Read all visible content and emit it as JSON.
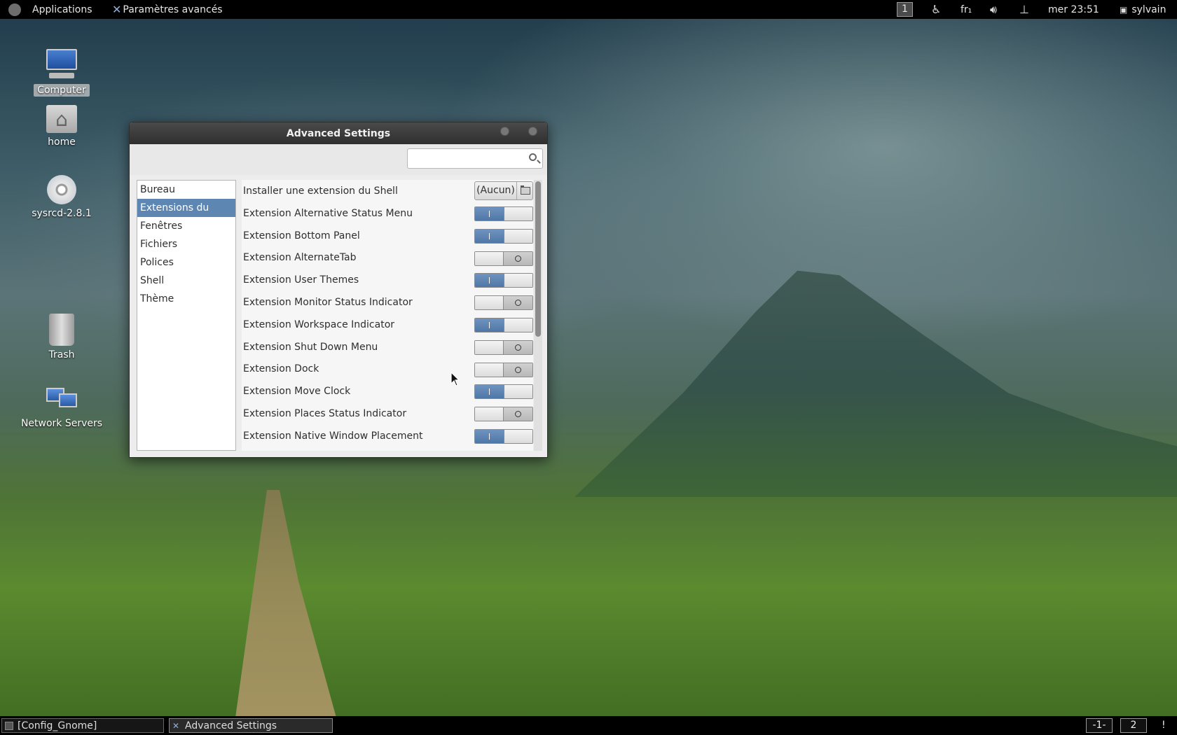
{
  "top_panel": {
    "applications": "Applications",
    "app_menu": "Paramètres avancés",
    "workspace": "1",
    "keyboard": "fr₁",
    "clock": "mer 23:51",
    "user": "sylvain",
    "icons": [
      "accessibility-icon",
      "volume-icon",
      "network-icon",
      "user-icon"
    ]
  },
  "desktop": {
    "icons": [
      {
        "label": "Computer",
        "selected": true
      },
      {
        "label": "home"
      },
      {
        "label": "sysrcd-2.8.1"
      },
      {
        "label": "Trash"
      },
      {
        "label": "Network Servers"
      }
    ]
  },
  "window": {
    "title": "Advanced Settings",
    "search": {
      "value": "",
      "placeholder": ""
    },
    "sidebar": {
      "items": [
        {
          "label": "Bureau"
        },
        {
          "label": "Extensions du Shell",
          "active": true
        },
        {
          "label": "Fenêtres"
        },
        {
          "label": "Fichiers"
        },
        {
          "label": "Polices"
        },
        {
          "label": "Shell"
        },
        {
          "label": "Thème"
        }
      ]
    },
    "install": {
      "label": "Installer une extension du Shell",
      "button": "(Aucun)"
    },
    "extensions": [
      {
        "label": "Extension Alternative Status Menu",
        "on": true
      },
      {
        "label": "Extension Bottom Panel",
        "on": true
      },
      {
        "label": "Extension AlternateTab",
        "on": false
      },
      {
        "label": "Extension User Themes",
        "on": true
      },
      {
        "label": "Extension Monitor Status Indicator",
        "on": false
      },
      {
        "label": "Extension Workspace Indicator",
        "on": true
      },
      {
        "label": "Extension Shut Down Menu",
        "on": false
      },
      {
        "label": "Extension Dock",
        "on": false
      },
      {
        "label": "Extension Move Clock",
        "on": true
      },
      {
        "label": "Extension Places Status Indicator",
        "on": false
      },
      {
        "label": "Extension Native Window Placement",
        "on": true
      }
    ]
  },
  "bottom_panel": {
    "tasks": [
      {
        "label": "[Config_Gnome]"
      },
      {
        "label": "Advanced Settings",
        "active": true
      }
    ],
    "workspaces": [
      "-1-",
      "2"
    ],
    "notify": "!"
  },
  "colors": {
    "accent": "#5e86b3",
    "toggle_on": "#5a80ad",
    "panel": "#000000"
  }
}
